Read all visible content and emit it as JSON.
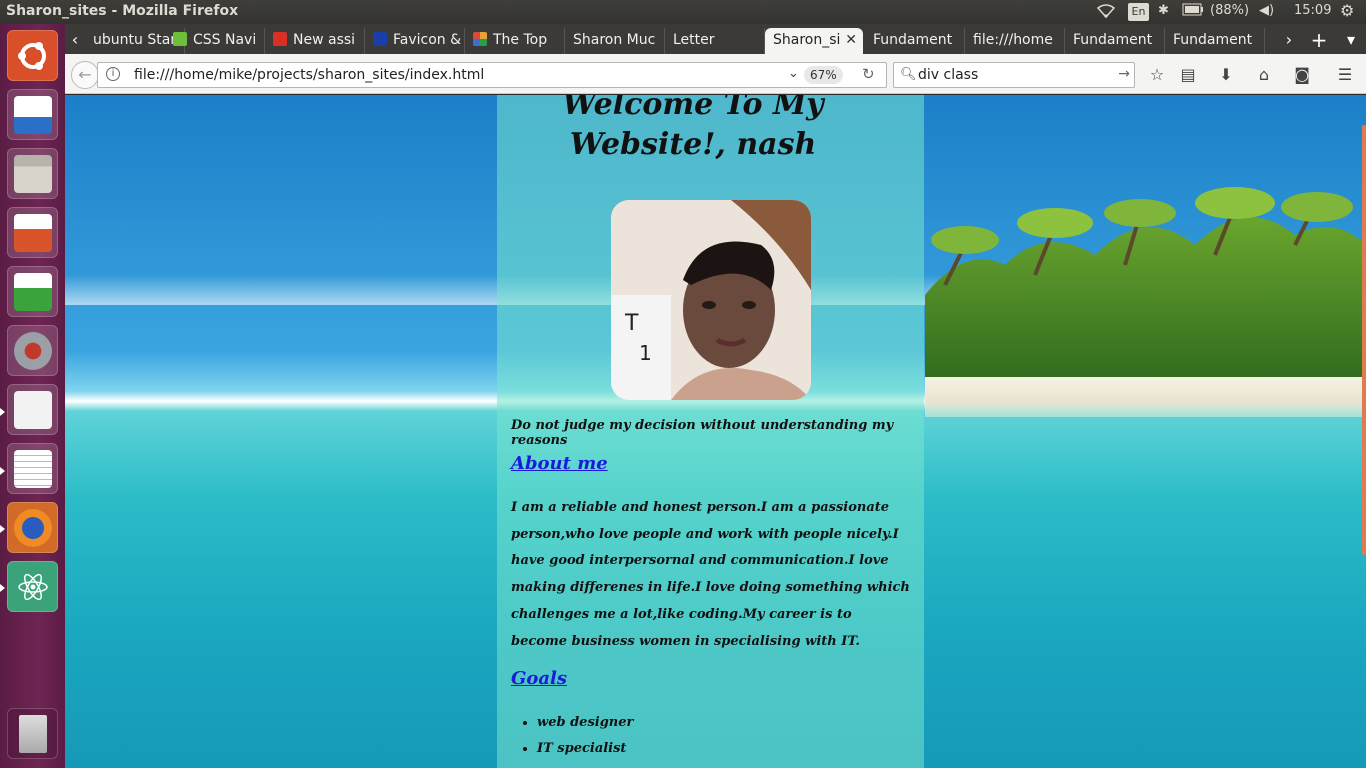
{
  "os": {
    "window_title": "Sharon_sites - Mozilla Firefox",
    "keyboard_lang": "En",
    "battery": "(88%)",
    "clock": "15:09"
  },
  "tabs": [
    {
      "label": "ubuntu Star",
      "favicon_color": "#dd4814",
      "active": false
    },
    {
      "label": "CSS Navi",
      "favicon_color": "#6bbf3a",
      "active": false
    },
    {
      "label": "New assi",
      "favicon_color": "#d93025",
      "active": false
    },
    {
      "label": "Favicon &",
      "favicon_color": "#1a3fa8",
      "active": false
    },
    {
      "label": "The Top",
      "favicon_color": "#e8a23a",
      "active": false
    },
    {
      "label": "Sharon Muc",
      "favicon_color": "",
      "active": false
    },
    {
      "label": "Letter",
      "favicon_color": "",
      "active": false
    },
    {
      "label": "Sharon_si",
      "favicon_color": "",
      "active": true
    },
    {
      "label": "Fundament",
      "favicon_color": "",
      "active": false
    },
    {
      "label": "file:///home",
      "favicon_color": "",
      "active": false
    },
    {
      "label": "Fundament",
      "favicon_color": "",
      "active": false
    },
    {
      "label": "Fundament",
      "favicon_color": "",
      "active": false
    }
  ],
  "navbar": {
    "url": "file:///home/mike/projects/sharon_sites/index.html",
    "zoom": "67%",
    "search_value": "div class"
  },
  "page": {
    "heading": "Welcome To My Website!, nash",
    "quote": "Do not judge my decision without understanding my reasons",
    "about_heading": "About me",
    "about_text": "I am a reliable and honest person.I am a passionate person,who love people and work with people nicely.I have good interpersornal and communication.I love making differenes in life.I love doing something which challenges me a lot,like coding.My career is to become business women in specialising with IT.",
    "goals_heading": "Goals",
    "goals": [
      "web designer",
      "IT specialist"
    ]
  },
  "colors": {
    "launcher": "#6e2553",
    "panel_overlay": "#78e6cd",
    "link": "#1a1adb"
  },
  "launcher_icons": [
    "ubuntu-dash-icon",
    "writer-icon",
    "files-icon",
    "impress-icon",
    "calc-icon",
    "settings-icon",
    "text-file-icon",
    "text-editor-icon",
    "firefox-icon",
    "atom-icon",
    "trash-icon"
  ]
}
